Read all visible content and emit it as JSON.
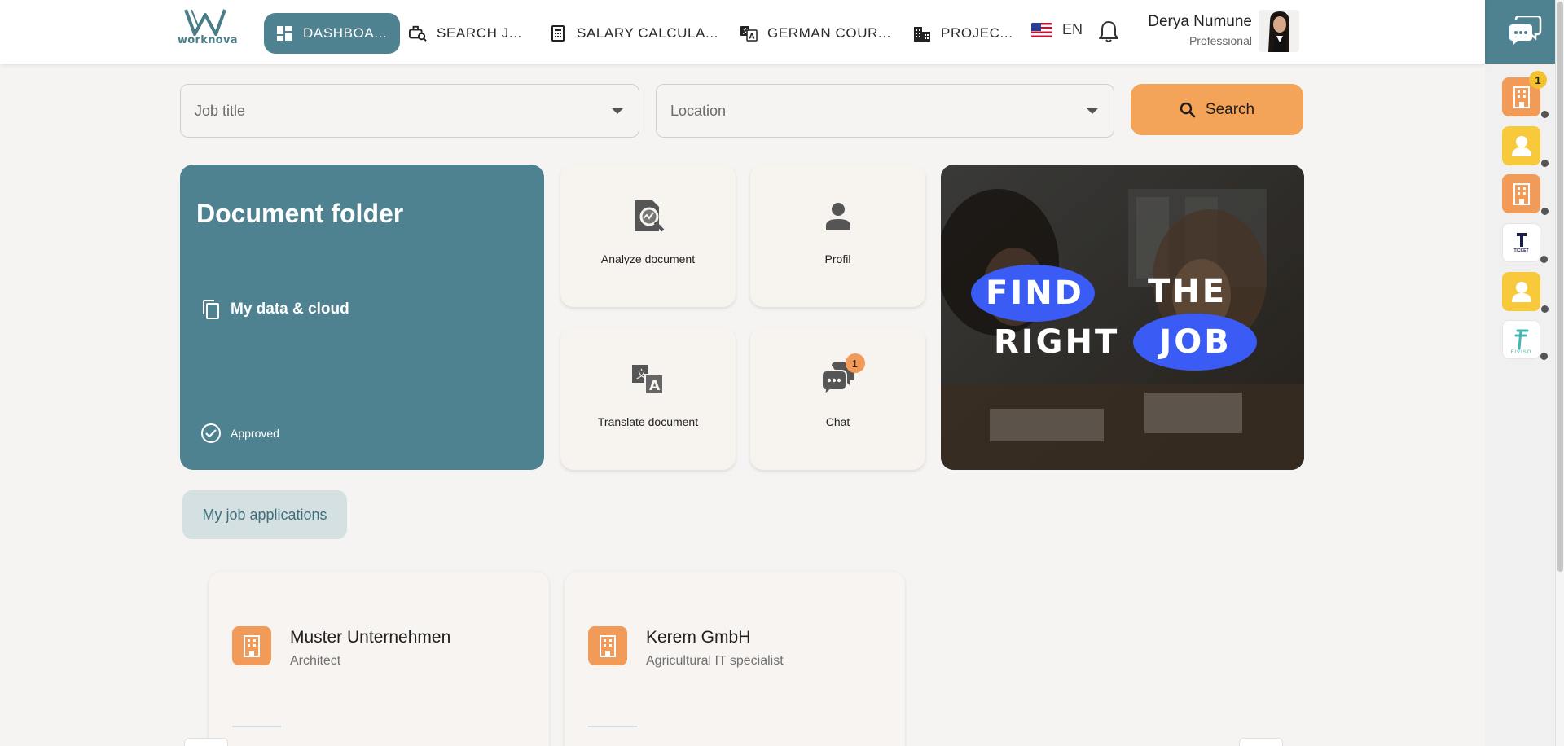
{
  "logo": {
    "text": "worknova"
  },
  "nav": {
    "dashboard": "DASHBOA...",
    "search_jobs": "SEARCH J...",
    "salary_calculator": "SALARY CALCULA...",
    "german_courses": "GERMAN COUR...",
    "projects": "PROJEC..."
  },
  "language": "EN",
  "user": {
    "name": "Derya Numune",
    "role": "Professional"
  },
  "search": {
    "job_title_placeholder": "Job title",
    "location_placeholder": "Location",
    "button": "Search"
  },
  "doc_folder": {
    "title": "Document folder",
    "my_data": "My data & cloud",
    "status": "Approved"
  },
  "tiles": {
    "analyze": "Analyze document",
    "profil": "Profil",
    "translate": "Translate document",
    "chat": "Chat",
    "chat_badge": "1"
  },
  "banner": {
    "line1_word1": "FIND",
    "line1_word2": "THE",
    "line2_word1": "RIGHT",
    "line2_word2": "JOB"
  },
  "applications": {
    "tab_label": "My job applications",
    "items": [
      {
        "company": "Muster Unternehmen",
        "role": "Architect"
      },
      {
        "company": "Kerem GmbH",
        "role": "Agricultural IT specialist"
      }
    ]
  },
  "rail": {
    "first_badge": "1",
    "ticket_text": "TICKET",
    "fiviso_text": "FIVISO"
  },
  "colors": {
    "teal": "#4f8290",
    "orange": "#f4a458",
    "yellow": "#f8c93a",
    "banner_blue": "#3b5bf5"
  },
  "icons": [
    "dashboard-icon",
    "briefcase-search-icon",
    "calculator-icon",
    "translate-icon",
    "buildings-icon",
    "us-flag-icon",
    "bell-icon",
    "chat-bubbles-icon",
    "search-icon",
    "copy-icon",
    "check-circle-icon",
    "analyze-document-icon",
    "person-icon",
    "translate-document-icon",
    "chat-icon",
    "building-icon"
  ]
}
